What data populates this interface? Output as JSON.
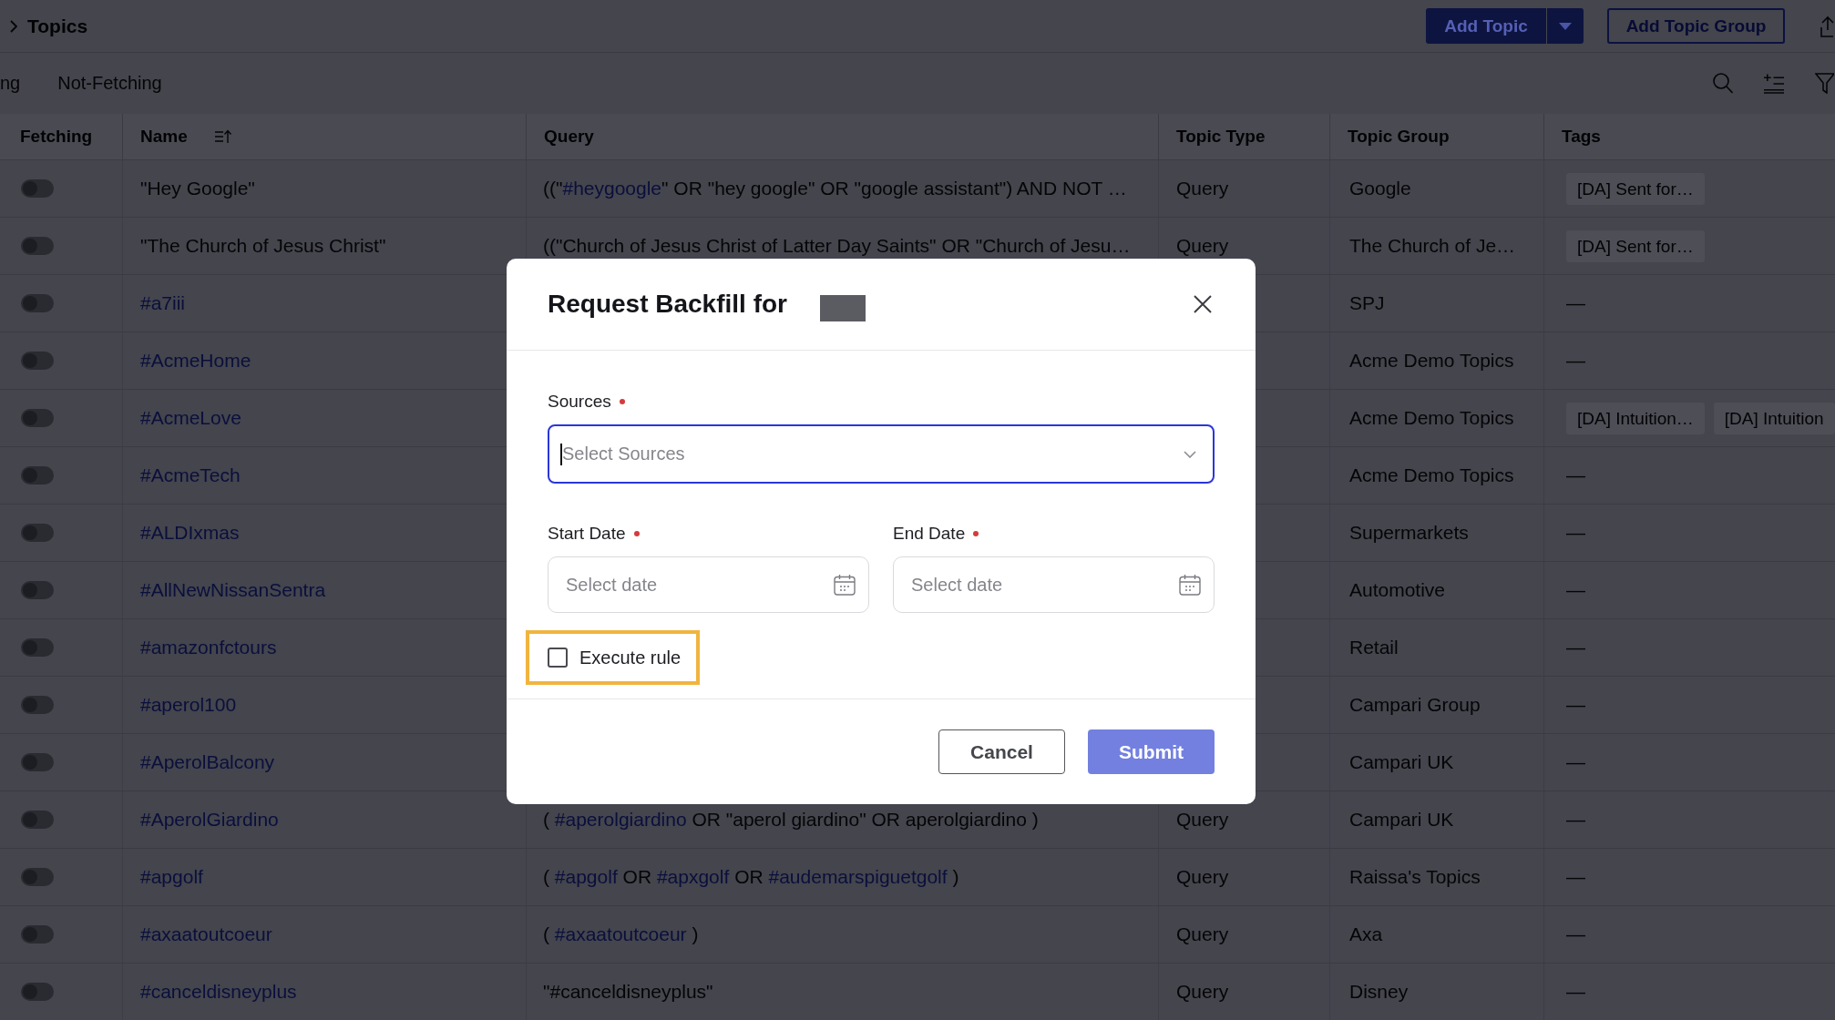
{
  "breadcrumb": {
    "current": "Topics"
  },
  "toolbar": {
    "add_topic": "Add Topic",
    "add_topic_group": "Add Topic Group"
  },
  "filter_tabs": [
    "ng",
    "Not-Fetching"
  ],
  "table": {
    "columns": [
      {
        "label": "Fetching",
        "sortable": false
      },
      {
        "label": "Name",
        "sortable": true
      },
      {
        "label": "Query",
        "sortable": false
      },
      {
        "label": "Topic Type",
        "sortable": false
      },
      {
        "label": "Topic Group",
        "sortable": false
      },
      {
        "label": "Tags",
        "sortable": false
      }
    ],
    "rows": [
      {
        "fetching": false,
        "kind": "phrase",
        "name": "\"Hey Google\"",
        "query": [
          {
            "kind": "text",
            "text": "((\""
          },
          {
            "kind": "hashtag",
            "text": "#heygoogle"
          },
          {
            "kind": "text",
            "text": "\" OR \"hey google\" OR \"google assistant\") AND NOT …"
          }
        ],
        "topic_type": "Query",
        "topic_group": "Google",
        "tags": [
          "[DA] Sent for…"
        ]
      },
      {
        "fetching": false,
        "kind": "phrase",
        "name": "\"The Church of Jesus Christ\"",
        "query": [
          {
            "kind": "text",
            "text": "((\"Church of Jesus Christ of Latter Day Saints\" OR \"Church of Jesu…"
          }
        ],
        "topic_type": "Query",
        "topic_group": "The Church of Je…",
        "tags": [
          "[DA] Sent for…"
        ]
      },
      {
        "fetching": false,
        "kind": "hashtag",
        "name": "#a7iii",
        "topic_group": "SPJ",
        "no_tags": "—"
      },
      {
        "fetching": false,
        "kind": "hashtag",
        "name": "#AcmeHome",
        "topic_group": "Acme Demo Topics",
        "no_tags": "—"
      },
      {
        "fetching": false,
        "kind": "hashtag",
        "name": "#AcmeLove",
        "topic_group": "Acme Demo Topics",
        "tags": [
          "[DA] Intuition…",
          "[DA] Intuition"
        ]
      },
      {
        "fetching": false,
        "kind": "hashtag",
        "name": "#AcmeTech",
        "topic_group": "Acme Demo Topics",
        "no_tags": "—"
      },
      {
        "fetching": false,
        "kind": "hashtag",
        "name": "#ALDIxmas",
        "topic_group": "Supermarkets",
        "no_tags": "—"
      },
      {
        "fetching": false,
        "kind": "hashtag",
        "name": "#AllNewNissanSentra",
        "topic_group": "Automotive",
        "no_tags": "—"
      },
      {
        "fetching": false,
        "kind": "hashtag",
        "name": "#amazonfctours",
        "topic_group": "Retail",
        "no_tags": "—"
      },
      {
        "fetching": false,
        "kind": "hashtag",
        "name": "#aperol100",
        "topic_group": "Campari Group",
        "no_tags": "—"
      },
      {
        "fetching": false,
        "kind": "hashtag",
        "name": "#AperolBalcony",
        "topic_group": "Campari UK",
        "no_tags": "—"
      },
      {
        "fetching": false,
        "kind": "hashtag",
        "name": "#AperolGiardino",
        "query": [
          {
            "kind": "text",
            "text": "( "
          },
          {
            "kind": "hashtag",
            "text": "#aperolgiardino"
          },
          {
            "kind": "text",
            "text": " OR \"aperol giardino\" OR aperolgiardino )"
          }
        ],
        "topic_type": "Query",
        "topic_group": "Campari UK",
        "no_tags": "—"
      },
      {
        "fetching": false,
        "kind": "hashtag",
        "name": "#apgolf",
        "query": [
          {
            "kind": "text",
            "text": "( "
          },
          {
            "kind": "hashtag",
            "text": "#apgolf"
          },
          {
            "kind": "text",
            "text": " OR "
          },
          {
            "kind": "hashtag",
            "text": "#apxgolf"
          },
          {
            "kind": "text",
            "text": " OR "
          },
          {
            "kind": "hashtag",
            "text": "#audemarspiguetgolf"
          },
          {
            "kind": "text",
            "text": " )"
          }
        ],
        "topic_type": "Query",
        "topic_group": "Raissa's Topics",
        "no_tags": "—"
      },
      {
        "fetching": false,
        "kind": "hashtag",
        "name": "#axaatoutcoeur",
        "query": [
          {
            "kind": "text",
            "text": "( "
          },
          {
            "kind": "hashtag",
            "text": "#axaatoutcoeur"
          },
          {
            "kind": "text",
            "text": " )"
          }
        ],
        "topic_type": "Query",
        "topic_group": "Axa",
        "no_tags": "—"
      },
      {
        "fetching": false,
        "kind": "hashtag",
        "name": "#canceldisneyplus",
        "query": [
          {
            "kind": "text",
            "text": "\"#canceldisneyplus\""
          }
        ],
        "topic_type": "Query",
        "topic_group": "Disney",
        "no_tags": "—"
      }
    ]
  },
  "modal": {
    "title": "Request Backfill for",
    "sources": {
      "label": "Sources",
      "required": true,
      "placeholder": "Select Sources",
      "focused": true
    },
    "dates": [
      {
        "label": "Start Date",
        "required": true,
        "placeholder": "Select date"
      },
      {
        "label": "End Date",
        "required": true,
        "placeholder": "Select date"
      }
    ],
    "execute_rule": {
      "label": "Execute rule",
      "checked": false,
      "highlighted": true
    },
    "buttons": [
      {
        "label": "Cancel",
        "kind": "secondary",
        "disabled": false
      },
      {
        "label": "Submit",
        "kind": "primary",
        "disabled": true
      }
    ]
  }
}
